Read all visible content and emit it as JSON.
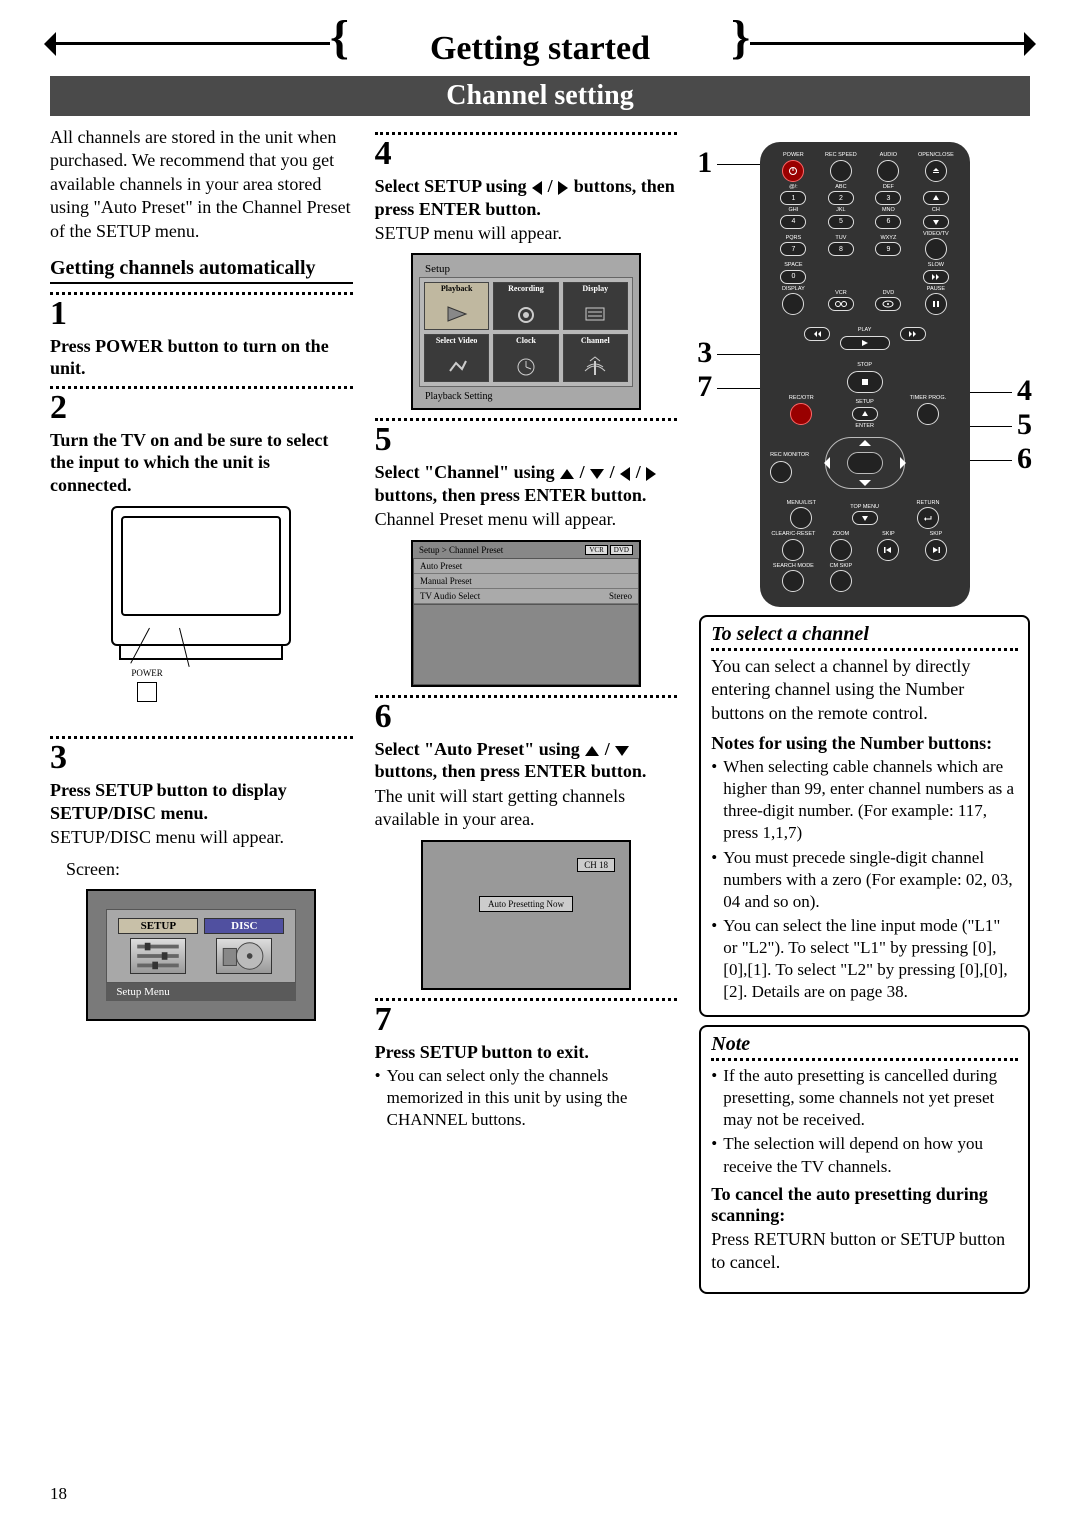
{
  "page": {
    "title": "Getting started",
    "section": "Channel setting",
    "number": "18"
  },
  "col1": {
    "intro": "All channels are stored in the unit when purchased. We recommend that you get available channels in your area stored using \"Auto Preset\" in the Channel Preset of the SETUP menu.",
    "subheading": "Getting channels automatically",
    "step1": {
      "num": "1",
      "bold": "Press POWER button to turn on the unit."
    },
    "step2": {
      "num": "2",
      "bold": "Turn the TV on and be sure to select the input to which the unit is connected."
    },
    "tv": {
      "power_label": "POWER"
    },
    "step3": {
      "num": "3",
      "bold": "Press SETUP button to display SETUP/DISC menu.",
      "body": "SETUP/DISC menu will appear.",
      "screen_label": "Screen:"
    },
    "sd_screen": {
      "setup": "SETUP",
      "disc": "DISC",
      "footer": "Setup Menu"
    }
  },
  "col2": {
    "step4": {
      "num": "4",
      "bold_a": "Select SETUP using ",
      "bold_b": " / ",
      "bold_c": " buttons, then press ENTER button.",
      "body": "SETUP menu will appear."
    },
    "setup_screen": {
      "title": "Setup",
      "tabs": [
        "Playback",
        "Recording",
        "Display",
        "Select Video",
        "Clock",
        "Channel"
      ],
      "footer": "Playback Setting"
    },
    "step5": {
      "num": "5",
      "bold_a": "Select \"Channel\" using ",
      "bold_b": " buttons, then press ENTER button.",
      "body": "Channel Preset menu will appear."
    },
    "cp_screen": {
      "crumb": "Setup > Channel Preset",
      "badges": [
        "VCR",
        "DVD"
      ],
      "rows": [
        {
          "l": "Auto Preset",
          "r": ""
        },
        {
          "l": "Manual Preset",
          "r": ""
        },
        {
          "l": "TV Audio Select",
          "r": "Stereo"
        }
      ]
    },
    "step6": {
      "num": "6",
      "bold_a": "Select \"Auto Preset\" using ",
      "bold_b": " buttons, then press ENTER button.",
      "body": "The unit will start getting channels available in your area."
    },
    "ap_screen": {
      "ch": "CH 18",
      "msg": "Auto Presetting Now"
    },
    "step7": {
      "num": "7",
      "bold": "Press SETUP button to exit.",
      "bullet": "You can select only the channels memorized in this unit by using the CHANNEL buttons."
    }
  },
  "col3": {
    "remote_nums": {
      "n1": "1",
      "n3": "3",
      "n7": "7",
      "n4": "4",
      "n5": "5",
      "n6": "6"
    },
    "remote_labels": {
      "power": "POWER",
      "recspeed": "REC SPEED",
      "audio": "AUDIO",
      "openclose": "OPEN/CLOSE",
      "atsym": "@/:",
      "abc": "ABC",
      "def": "DEF",
      "ghi": "GHI",
      "jkl": "JKL",
      "mno": "MNO",
      "ch": "CH",
      "pqrs": "PQRS",
      "tuv": "TUV",
      "wxyz": "WXYZ",
      "videotv": "VIDEO/TV",
      "space": "SPACE",
      "slow": "SLOW",
      "display": "DISPLAY",
      "vcr": "VCR",
      "dvd": "DVD",
      "pause": "PAUSE",
      "play": "PLAY",
      "stop": "STOP",
      "recotr": "REC/OTR",
      "setup": "SETUP",
      "timerprog": "TIMER PROG.",
      "recmonitor": "REC MONITOR",
      "enter": "ENTER",
      "menulist": "MENU/LIST",
      "topmenu": "TOP MENU",
      "return": "RETURN",
      "clearcreset": "CLEAR/C-RESET",
      "zoom": "ZOOM",
      "skip": "SKIP",
      "searchmode": "SEARCH MODE",
      "cmskip": "CM SKIP",
      "d1": "1",
      "d2": "2",
      "d3": "3",
      "d4": "4",
      "d5": "5",
      "d6": "6",
      "d7": "7",
      "d8": "8",
      "d9": "9",
      "d0": "0"
    },
    "select_channel": {
      "title": "To select a channel",
      "body": "You can select a channel by directly entering channel using the Number buttons on the remote control.",
      "notes_head": "Notes for using the Number buttons:",
      "bullets": [
        "When selecting cable channels which are higher than 99, enter channel numbers as a three-digit number. (For example: 117, press 1,1,7)",
        "You must precede single-digit channel numbers with a zero (For example: 02, 03, 04 and so on).",
        "You can select the line input mode (\"L1\" or \"L2\"). To select \"L1\" by pressing [0],[0],[1]. To select \"L2\" by pressing [0],[0],[2]. Details are on page 38."
      ]
    },
    "note_box": {
      "title": "Note",
      "bullets": [
        "If the auto presetting is cancelled during presetting, some channels not yet preset may not be received.",
        "The selection will depend on how you receive the TV channels."
      ],
      "cancel_head": "To cancel the auto presetting during scanning:",
      "cancel_body": "Press RETURN button or SETUP button to cancel."
    }
  }
}
